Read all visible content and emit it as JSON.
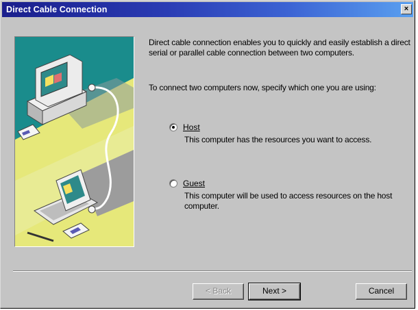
{
  "window": {
    "title": "Direct Cable Connection",
    "close_glyph": "×"
  },
  "intro": {
    "paragraph1": "Direct cable connection enables you to quickly and easily establish a direct serial or parallel cable connection between two computers.",
    "paragraph2": "To connect two computers now, specify which one you are using:"
  },
  "options": [
    {
      "label": "Host",
      "checked": true,
      "description": "This computer has the resources you want to access."
    },
    {
      "label": "Guest",
      "checked": false,
      "description": "This computer will be used to access resources on the host computer."
    }
  ],
  "buttons": {
    "back": "< Back",
    "next": "Next >",
    "cancel": "Cancel"
  },
  "colors": {
    "illustration_teal": "#1a8c8c",
    "illustration_yellow": "#e6e87a",
    "title_gradient_start": "#1a1e8c",
    "title_gradient_end": "#5aa0f0"
  },
  "icons": {
    "close": "close-icon",
    "illustration": "computers-cable-illustration"
  }
}
